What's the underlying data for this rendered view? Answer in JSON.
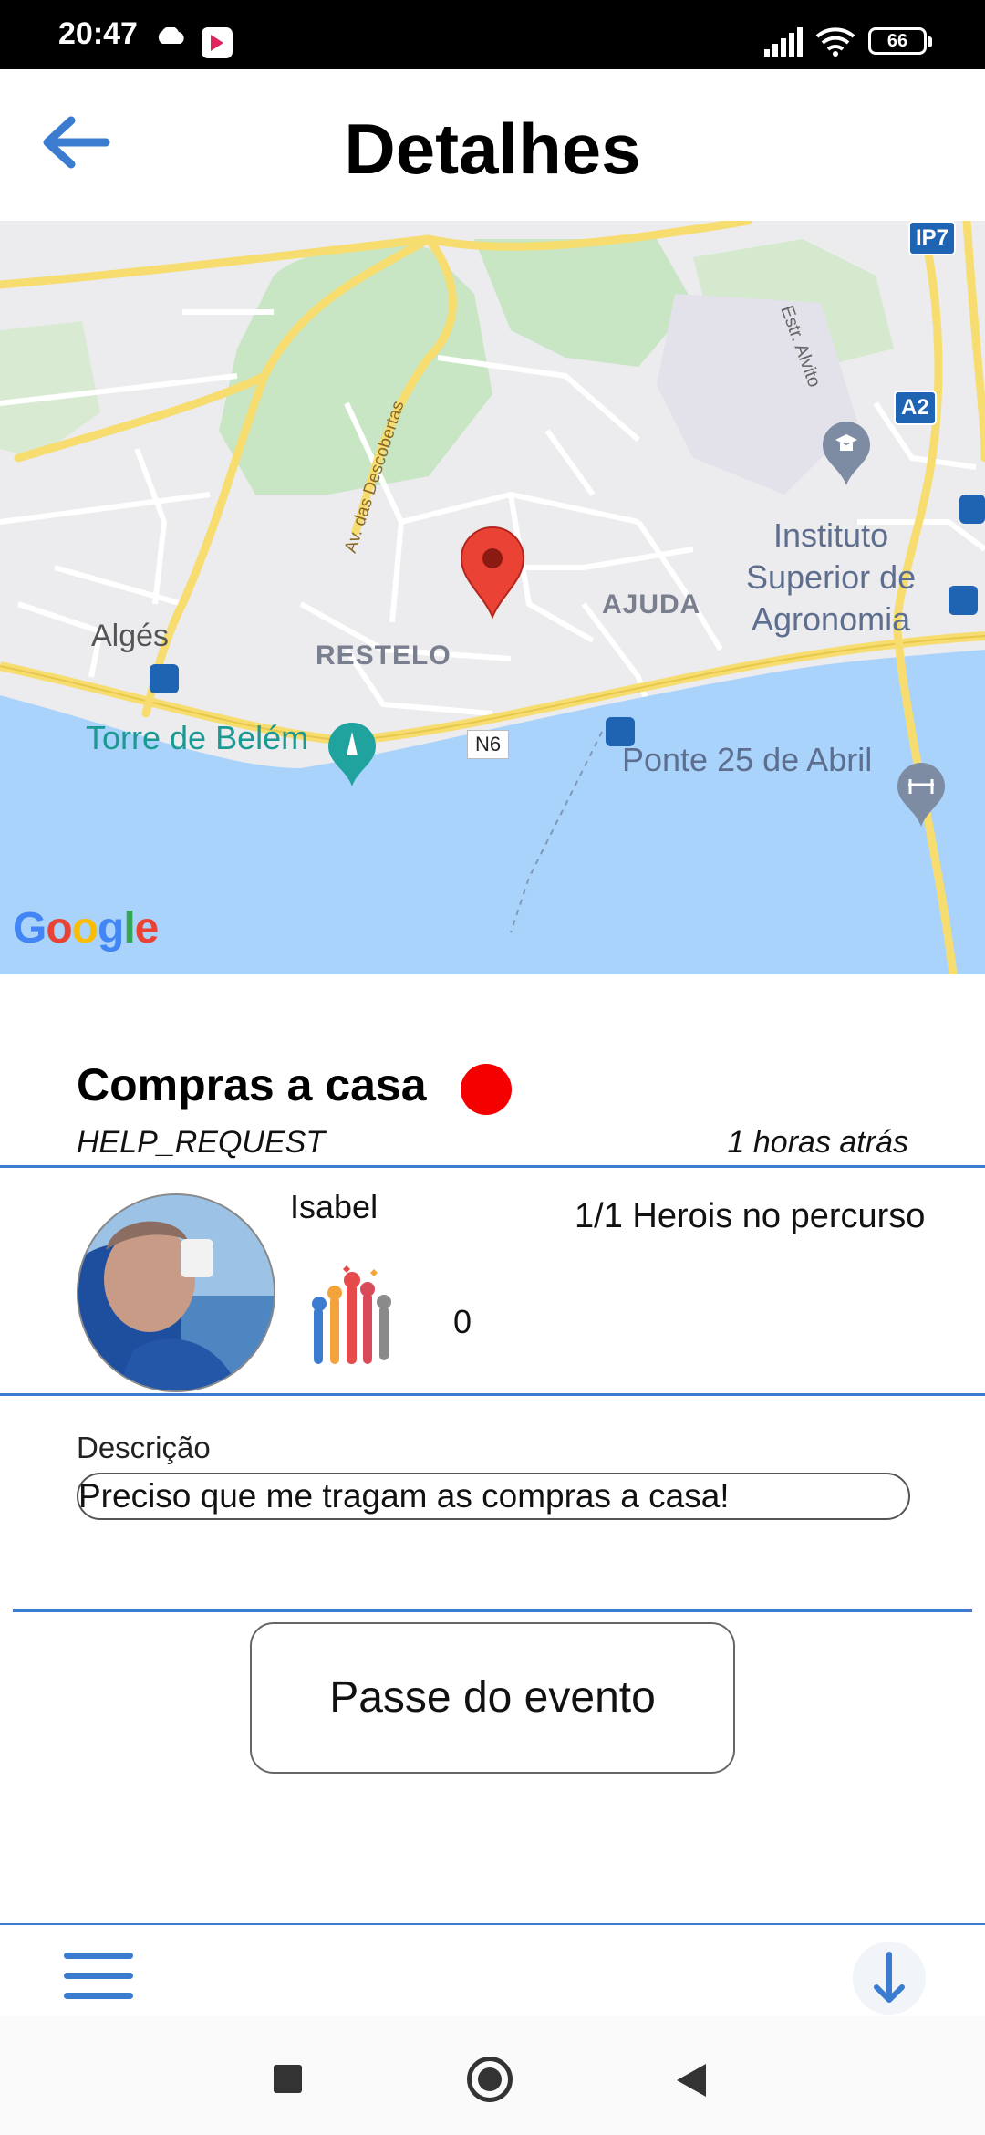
{
  "status_bar": {
    "time": "20:47",
    "battery": "66"
  },
  "header": {
    "title": "Detalhes"
  },
  "map": {
    "labels": {
      "alges": "Algés",
      "restelo": "RESTELO",
      "ajuda": "AJUDA",
      "instituto": [
        "Instituto",
        "Superior de",
        "Agronomia"
      ],
      "torre": "Torre de Belém",
      "ponte": "Ponte 25 de Abril",
      "avenida": "Av. das Descobertas",
      "estrada": "Estr. Alvito",
      "ip7": "IP7",
      "a2": "A2",
      "n6": "N6",
      "google": "Google"
    },
    "colors": {
      "water": "#aad3fb",
      "park": "#c8e6c4",
      "road_major": "#f7dd6f",
      "land": "#ecebee",
      "pin": "#ea4335"
    }
  },
  "event": {
    "title": "Compras a casa",
    "status_color": "#f40000",
    "type": "HELP_REQUEST",
    "time_ago": "1 horas atrás"
  },
  "user": {
    "name": "Isabel",
    "heroes": "1/1 Herois no percurso",
    "score": "0"
  },
  "description": {
    "label": "Descrição",
    "value": "Preciso que me tragam as compras a casa!"
  },
  "actions": {
    "pass_event": "Passe do evento"
  },
  "accent": "#3b7bd0"
}
